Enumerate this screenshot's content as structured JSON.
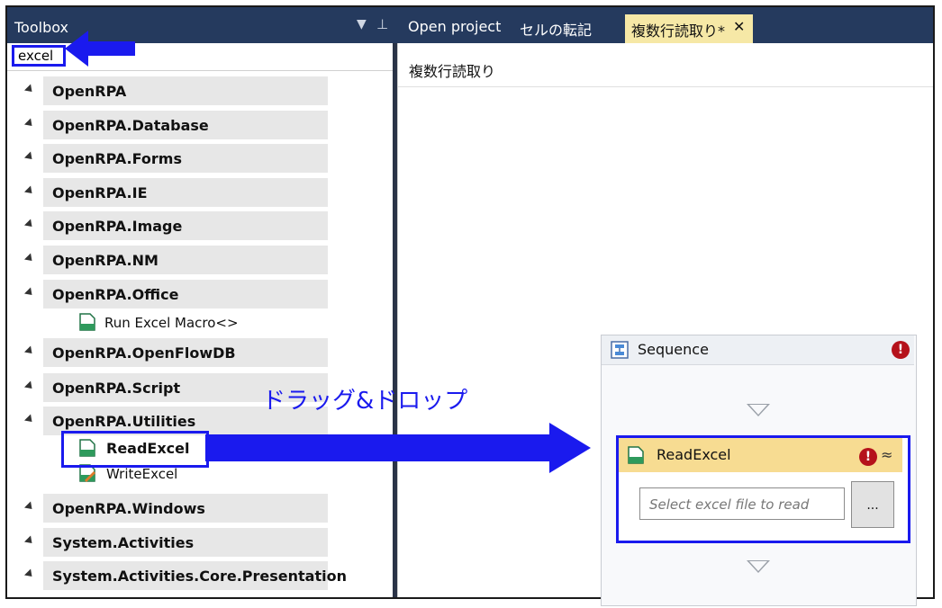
{
  "toolbox": {
    "title": "Toolbox",
    "dropdown_glyph": "▼",
    "pin_glyph": "⊥",
    "search_value": "excel",
    "categories": [
      {
        "label": "OpenRPA"
      },
      {
        "label": "OpenRPA.Database"
      },
      {
        "label": "OpenRPA.Forms"
      },
      {
        "label": "OpenRPA.IE"
      },
      {
        "label": "OpenRPA.Image"
      },
      {
        "label": "OpenRPA.NM"
      },
      {
        "label": "OpenRPA.Office"
      },
      {
        "label": "OpenRPA.OpenFlowDB"
      },
      {
        "label": "OpenRPA.Script"
      },
      {
        "label": "OpenRPA.Utilities"
      },
      {
        "label": "OpenRPA.Windows"
      },
      {
        "label": "System.Activities"
      },
      {
        "label": "System.Activities.Core.Presentation"
      }
    ],
    "office_items": [
      {
        "label": "Run Excel Macro<>"
      }
    ],
    "utilities_items": [
      {
        "label": "ReadExcel"
      },
      {
        "label": "WriteExcel"
      }
    ]
  },
  "tabs": {
    "open_project": "Open project",
    "cell_copy": "セルの転記",
    "active_tab": "複数行読取り*",
    "close_glyph": "✕"
  },
  "designer": {
    "breadcrumb": "複数行読取り",
    "sequence_title": "Sequence",
    "error_glyph": "!",
    "collapse_glyph": "≈",
    "read_excel": {
      "title": "ReadExcel",
      "file_placeholder": "Select excel file to read",
      "browse_label": "..."
    }
  },
  "annotation": {
    "drag_drop_label": "ドラッグ&ドロップ"
  },
  "colors": {
    "title_bar": "#253a5e",
    "active_tab": "#f6e8a6",
    "highlight": "#1a1aee",
    "error": "#b5121b",
    "activity_header": "#f7dc92"
  }
}
